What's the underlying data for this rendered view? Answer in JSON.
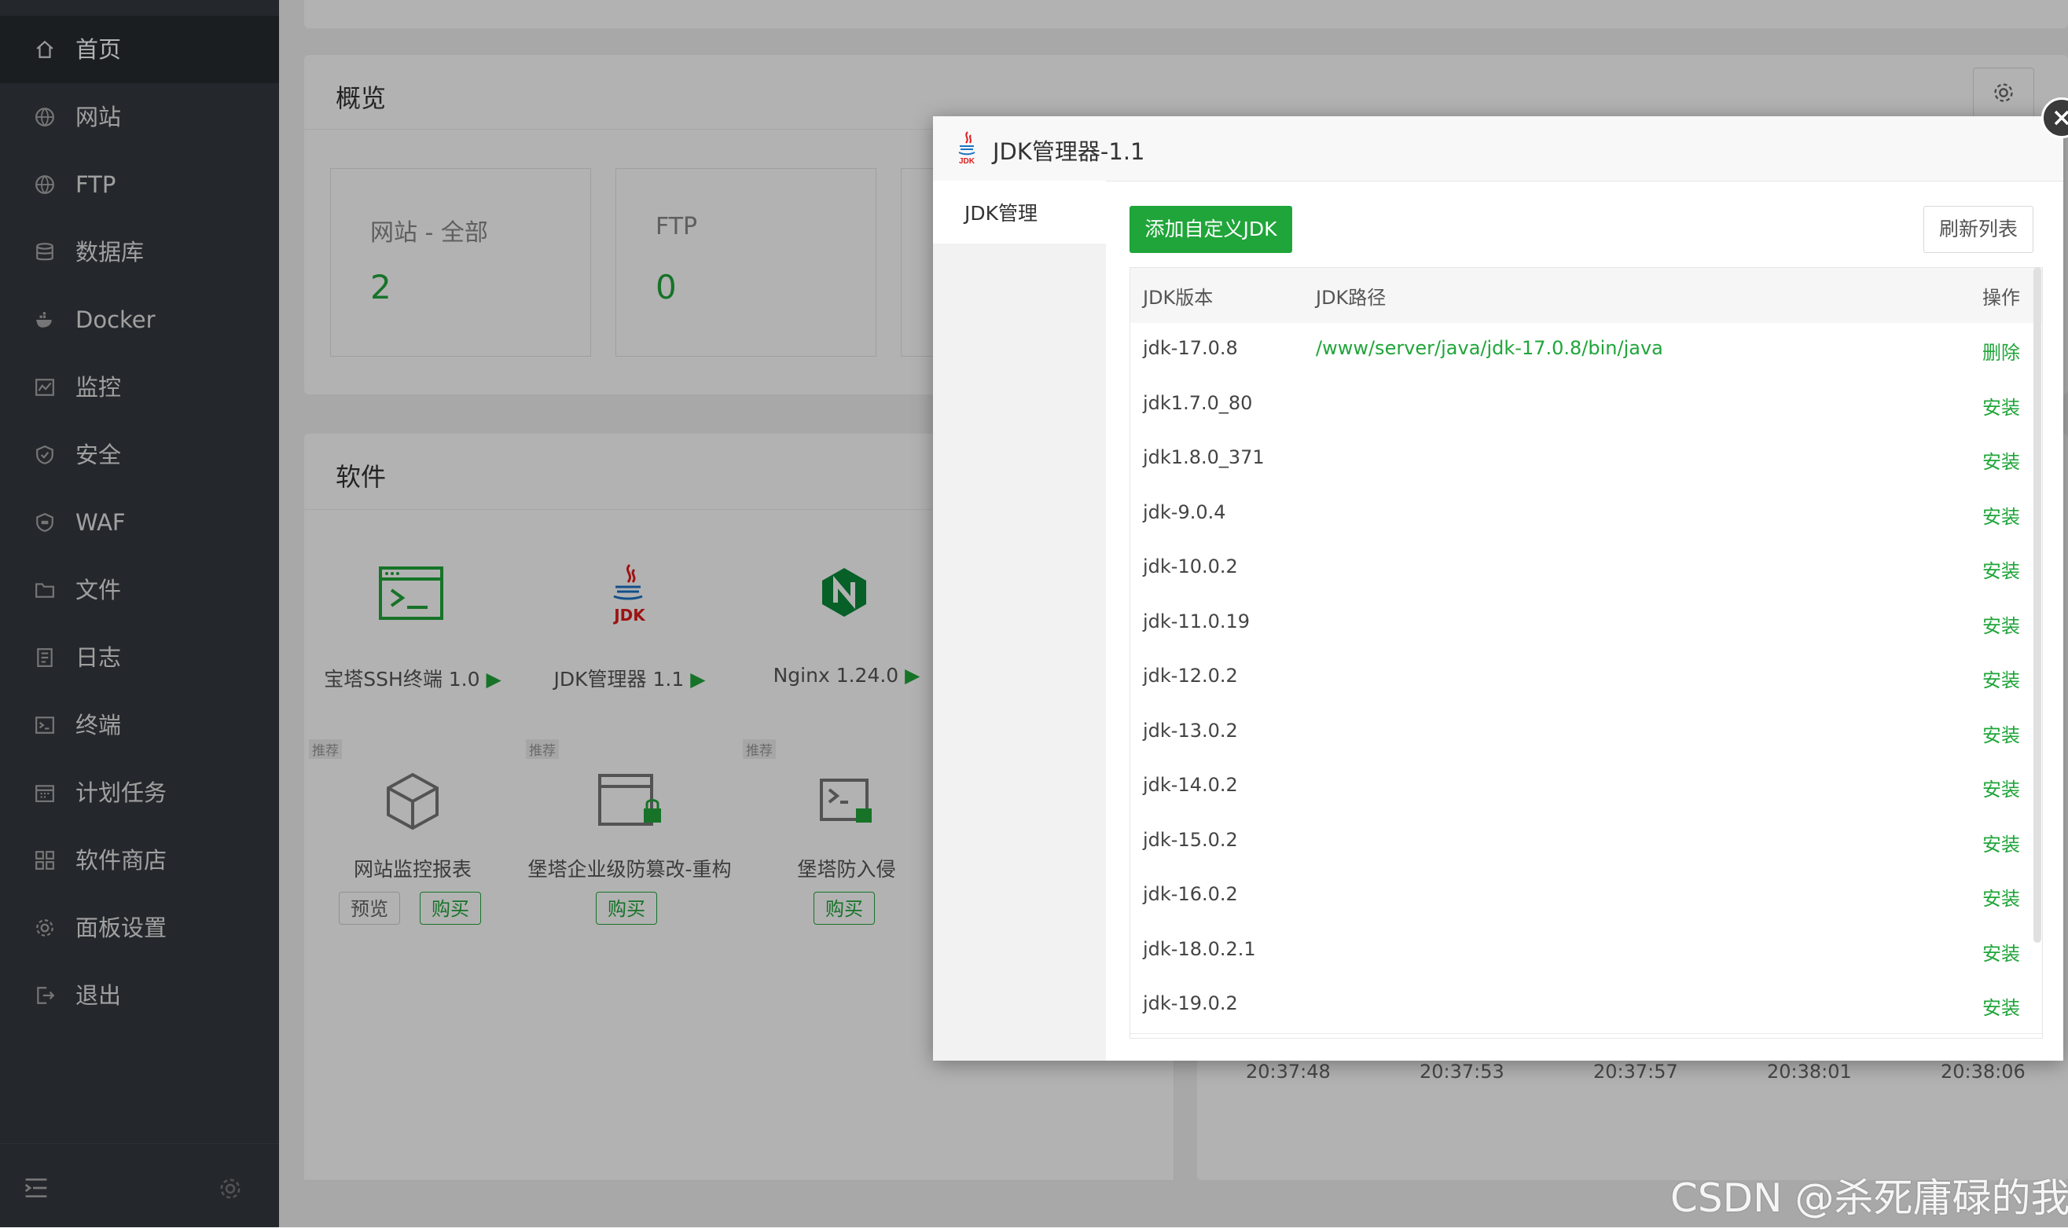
{
  "sidebar": {
    "items": [
      {
        "label": "首页",
        "icon": "home-icon"
      },
      {
        "label": "网站",
        "icon": "globe-icon"
      },
      {
        "label": "FTP",
        "icon": "globe-icon"
      },
      {
        "label": "数据库",
        "icon": "database-icon"
      },
      {
        "label": "Docker",
        "icon": "docker-icon"
      },
      {
        "label": "监控",
        "icon": "monitor-icon"
      },
      {
        "label": "安全",
        "icon": "shield-icon"
      },
      {
        "label": "WAF",
        "icon": "waf-shield-icon"
      },
      {
        "label": "文件",
        "icon": "folder-icon"
      },
      {
        "label": "日志",
        "icon": "log-icon"
      },
      {
        "label": "终端",
        "icon": "terminal-icon"
      },
      {
        "label": "计划任务",
        "icon": "calendar-icon"
      },
      {
        "label": "软件商店",
        "icon": "grid-icon"
      },
      {
        "label": "面板设置",
        "icon": "gear-icon"
      },
      {
        "label": "退出",
        "icon": "logout-icon"
      }
    ]
  },
  "overview": {
    "title": "概览",
    "cards": [
      {
        "label": "网站 - 全部",
        "value": "2"
      },
      {
        "label": "FTP",
        "value": "0"
      }
    ]
  },
  "software": {
    "title": "软件",
    "installed": [
      {
        "name": "宝塔SSH终端 1.0"
      },
      {
        "name": "JDK管理器 1.1"
      },
      {
        "name": "Nginx 1.24.0"
      }
    ],
    "recommended_tag": "推荐",
    "recommended": [
      {
        "name": "网站监控报表",
        "preview": "预览",
        "buy": "购买"
      },
      {
        "name": "堡塔企业级防篡改-重构",
        "buy": "购买"
      },
      {
        "name": "堡塔防入侵",
        "buy": "购买"
      }
    ]
  },
  "chart_times": [
    "20:37:48",
    "20:37:53",
    "20:37:57",
    "20:38:01",
    "20:38:06"
  ],
  "modal": {
    "title": "JDK管理器-1.1",
    "logo_text": "JDK",
    "tab": "JDK管理",
    "add_button": "添加自定义JDK",
    "refresh_button": "刷新列表",
    "columns": {
      "version": "JDK版本",
      "path": "JDK路径",
      "action": "操作"
    },
    "rows": [
      {
        "version": "jdk-17.0.8",
        "path": "/www/server/java/jdk-17.0.8/bin/java",
        "action": "删除"
      },
      {
        "version": "jdk1.7.0_80",
        "path": "",
        "action": "安装"
      },
      {
        "version": "jdk1.8.0_371",
        "path": "",
        "action": "安装"
      },
      {
        "version": "jdk-9.0.4",
        "path": "",
        "action": "安装"
      },
      {
        "version": "jdk-10.0.2",
        "path": "",
        "action": "安装"
      },
      {
        "version": "jdk-11.0.19",
        "path": "",
        "action": "安装"
      },
      {
        "version": "jdk-12.0.2",
        "path": "",
        "action": "安装"
      },
      {
        "version": "jdk-13.0.2",
        "path": "",
        "action": "安装"
      },
      {
        "version": "jdk-14.0.2",
        "path": "",
        "action": "安装"
      },
      {
        "version": "jdk-15.0.2",
        "path": "",
        "action": "安装"
      },
      {
        "version": "jdk-16.0.2",
        "path": "",
        "action": "安装"
      },
      {
        "version": "jdk-18.0.2.1",
        "path": "",
        "action": "安装"
      },
      {
        "version": "jdk-19.0.2",
        "path": "",
        "action": "安装"
      }
    ]
  },
  "watermark": "CSDN @杀死庸碌的我",
  "colors": {
    "accent": "#20a53a",
    "sidebar_bg": "#343a40",
    "sidebar_active": "#272c30"
  }
}
